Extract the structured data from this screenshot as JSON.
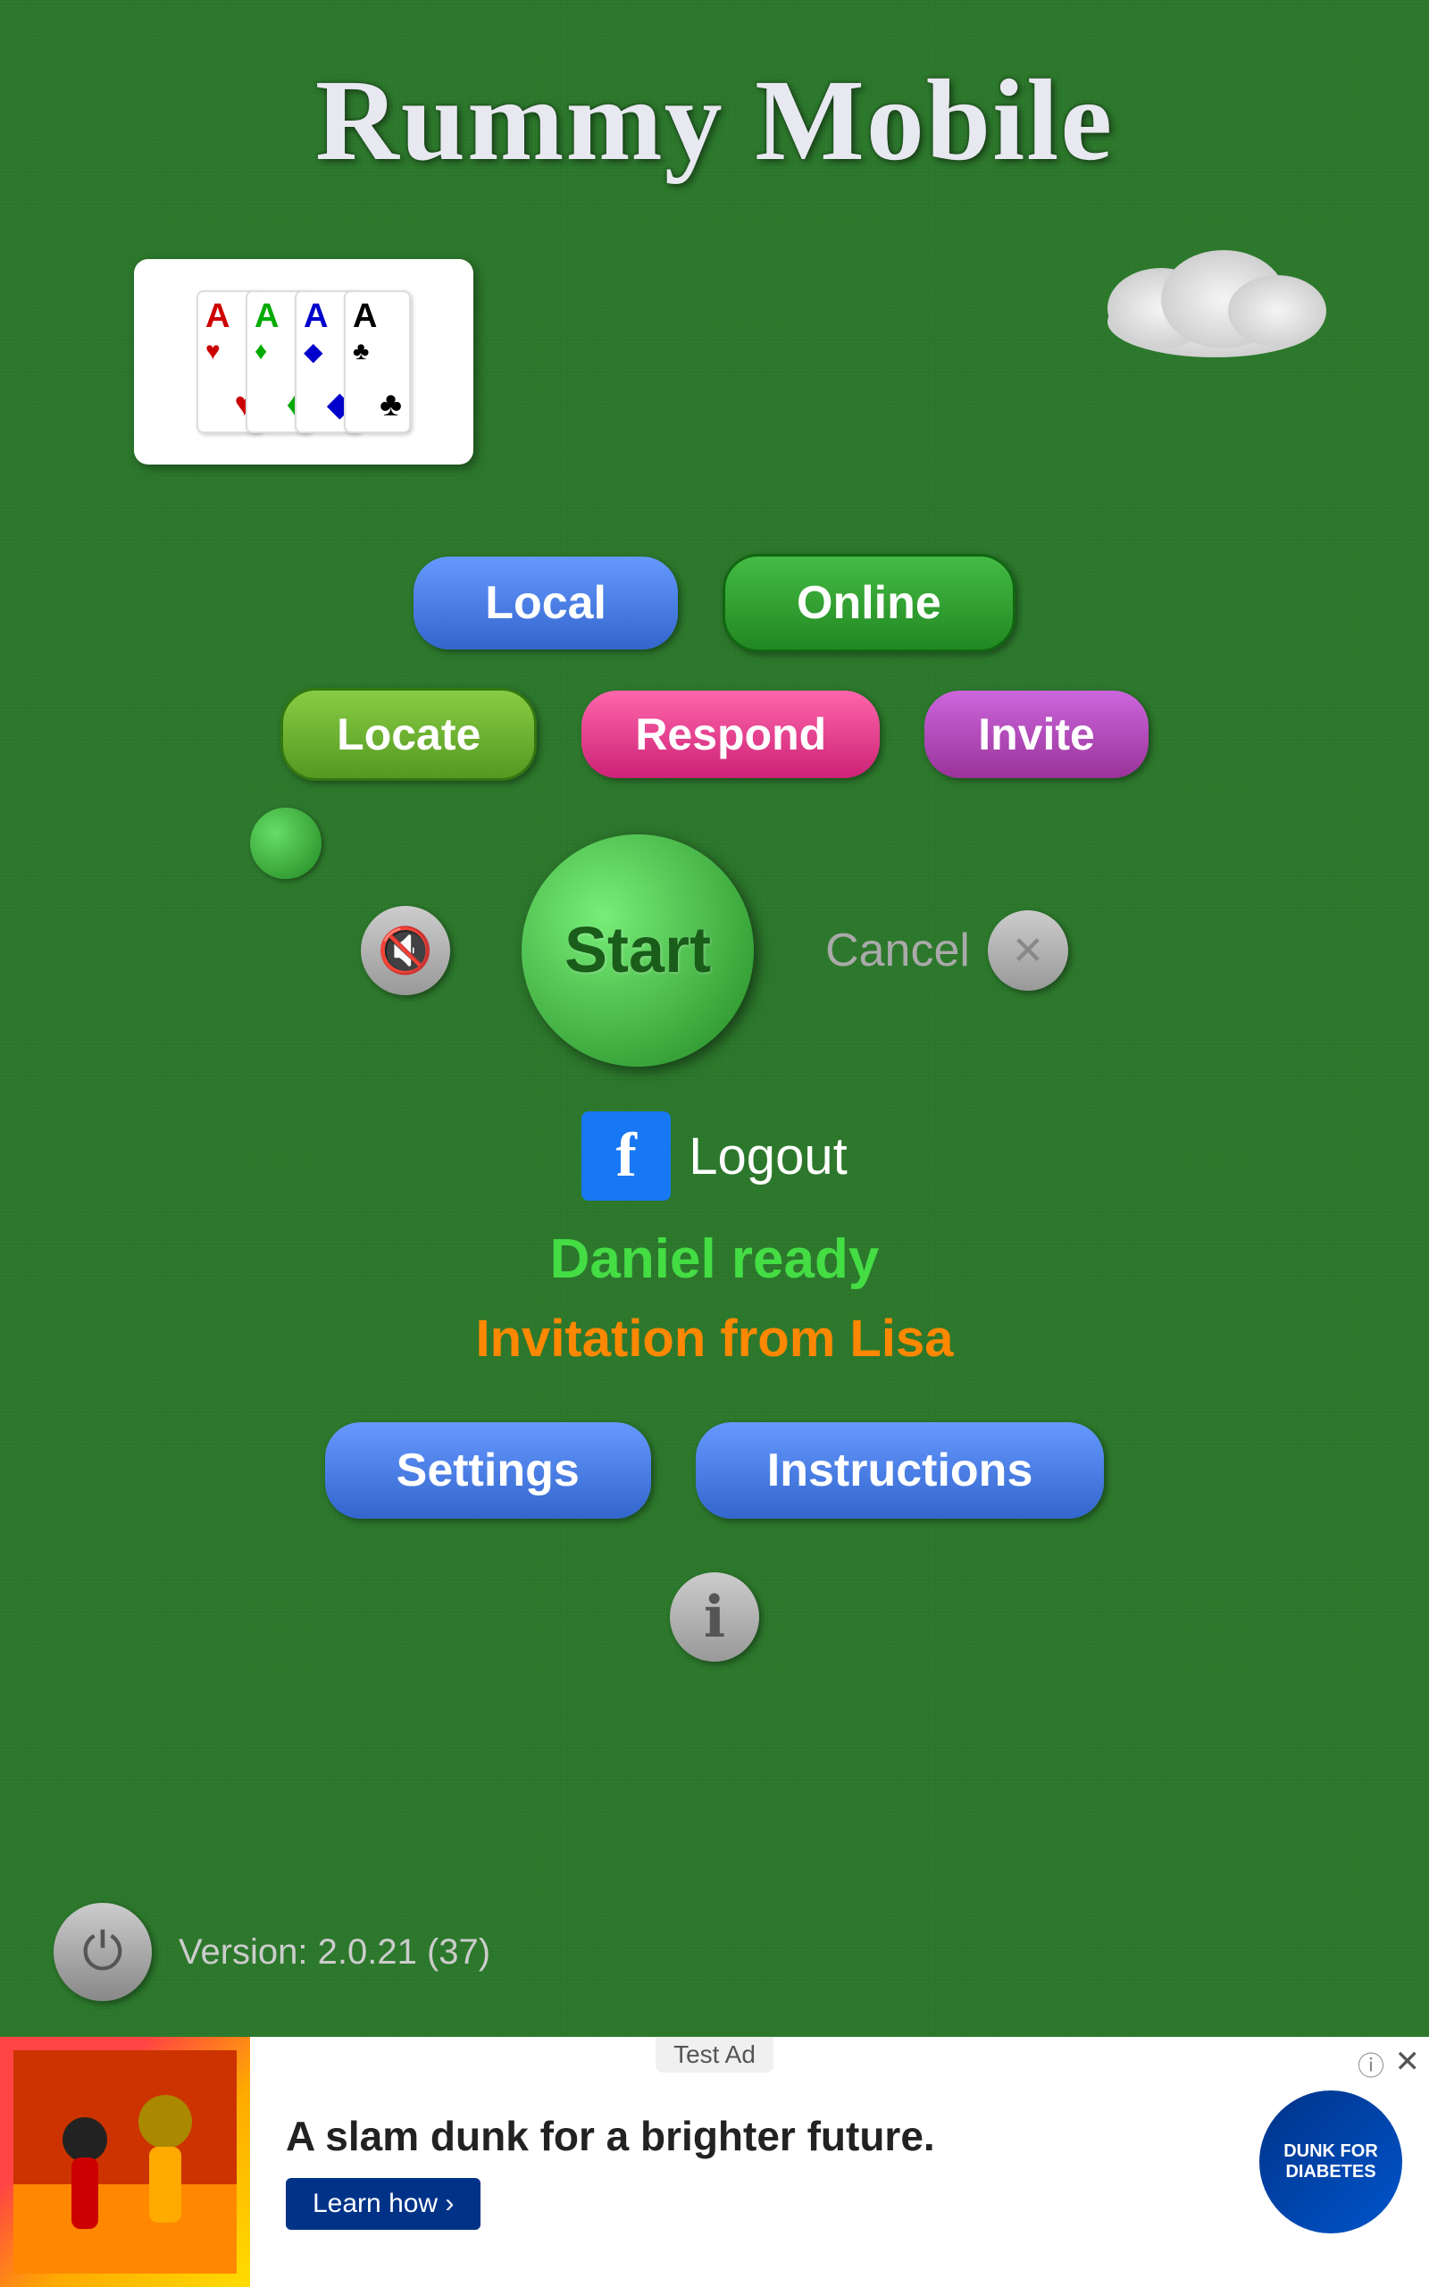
{
  "title": "Rummy Mobile",
  "buttons": {
    "local": "Local",
    "online": "Online",
    "locate": "Locate",
    "respond": "Respond",
    "invite": "Invite",
    "start": "Start",
    "cancel": "Cancel",
    "logout": "Logout",
    "settings": "Settings",
    "instructions": "Instructions"
  },
  "status": {
    "daniel_ready": "Daniel ready",
    "invitation": "Invitation from Lisa"
  },
  "version": "Version: 2.0.21 (37)",
  "ad": {
    "test_label": "Test Ad",
    "title": "A slam dunk for a brighter future.",
    "learn_more": "Learn how ›",
    "logo_text": "DUNK FOR DIABETES"
  },
  "cards": [
    {
      "letter": "A",
      "suit": "♥",
      "color": "card-red"
    },
    {
      "letter": "A",
      "suit": "♦",
      "color": "card-green"
    },
    {
      "letter": "A",
      "suit": "♦",
      "color": "card-blue"
    },
    {
      "letter": "A",
      "suit": "♣",
      "color": "card-black"
    }
  ]
}
